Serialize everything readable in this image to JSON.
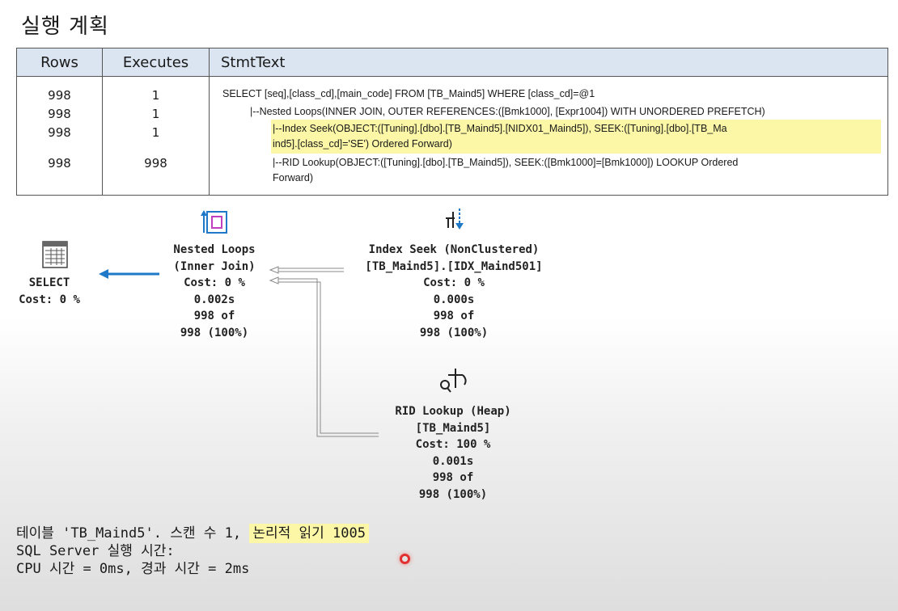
{
  "title": "실행 계획",
  "table": {
    "headers": {
      "rows": "Rows",
      "executes": "Executes",
      "stmttext": "StmtText"
    },
    "rows": [
      {
        "rows": "998",
        "executes": "1",
        "text1": "SELECT [seq],[class_cd],[main_code] FROM [TB_Maind5] WHERE [class_cd]=@1",
        "text2": ""
      },
      {
        "rows": "998",
        "executes": "1",
        "text1": "|--Nested Loops(INNER JOIN, OUTER REFERENCES:([Bmk1000], [Expr1004]) WITH UNORDERED PREFETCH)",
        "text2": ""
      },
      {
        "rows": "998",
        "executes": "1",
        "text1": "|--Index Seek(OBJECT:([Tuning].[dbo].[TB_Maind5].[NIDX01_Maind5]), SEEK:([Tuning].[dbo].[TB_Ma",
        "text2": "ind5].[class_cd]='SE') Ordered Forward)"
      },
      {
        "rows": "998",
        "executes": "998",
        "text1": "|--RID Lookup(OBJECT:([Tuning].[dbo].[TB_Maind5]), SEEK:([Bmk1000]=[Bmk1000]) LOOKUP Ordered",
        "text2": "Forward)"
      }
    ]
  },
  "plan": {
    "select": {
      "line1": "SELECT",
      "line2": "Cost: 0 %"
    },
    "nested": {
      "line1": "Nested Loops",
      "line2": "(Inner Join)",
      "line3": "Cost: 0 %",
      "line4": "0.002s",
      "line5": "998 of",
      "line6": "998 (100%)"
    },
    "seek": {
      "line1": "Index Seek (NonClustered)",
      "line2": "[TB_Maind5].[IDX_Maind501]",
      "line3": "Cost: 0 %",
      "line4": "0.000s",
      "line5": "998 of",
      "line6": "998 (100%)"
    },
    "rid": {
      "line1": "RID Lookup (Heap)",
      "line2": "[TB_Maind5]",
      "line3": "Cost: 100 %",
      "line4": "0.001s",
      "line5": "998 of",
      "line6": "998 (100%)"
    }
  },
  "footer": {
    "line1_a": "테이블 'TB_Maind5'. 스캔 수 1,",
    "line1_b": "논리적 읽기 1005",
    "line2": "SQL Server 실행 시간:",
    "line3": "CPU 시간 = 0ms, 경과 시간 = 2ms"
  },
  "colors": {
    "highlight": "#fbf7a6",
    "header_bg": "#dbe5f1",
    "arrow": "#1f78c8",
    "cursor": "#e23030"
  }
}
